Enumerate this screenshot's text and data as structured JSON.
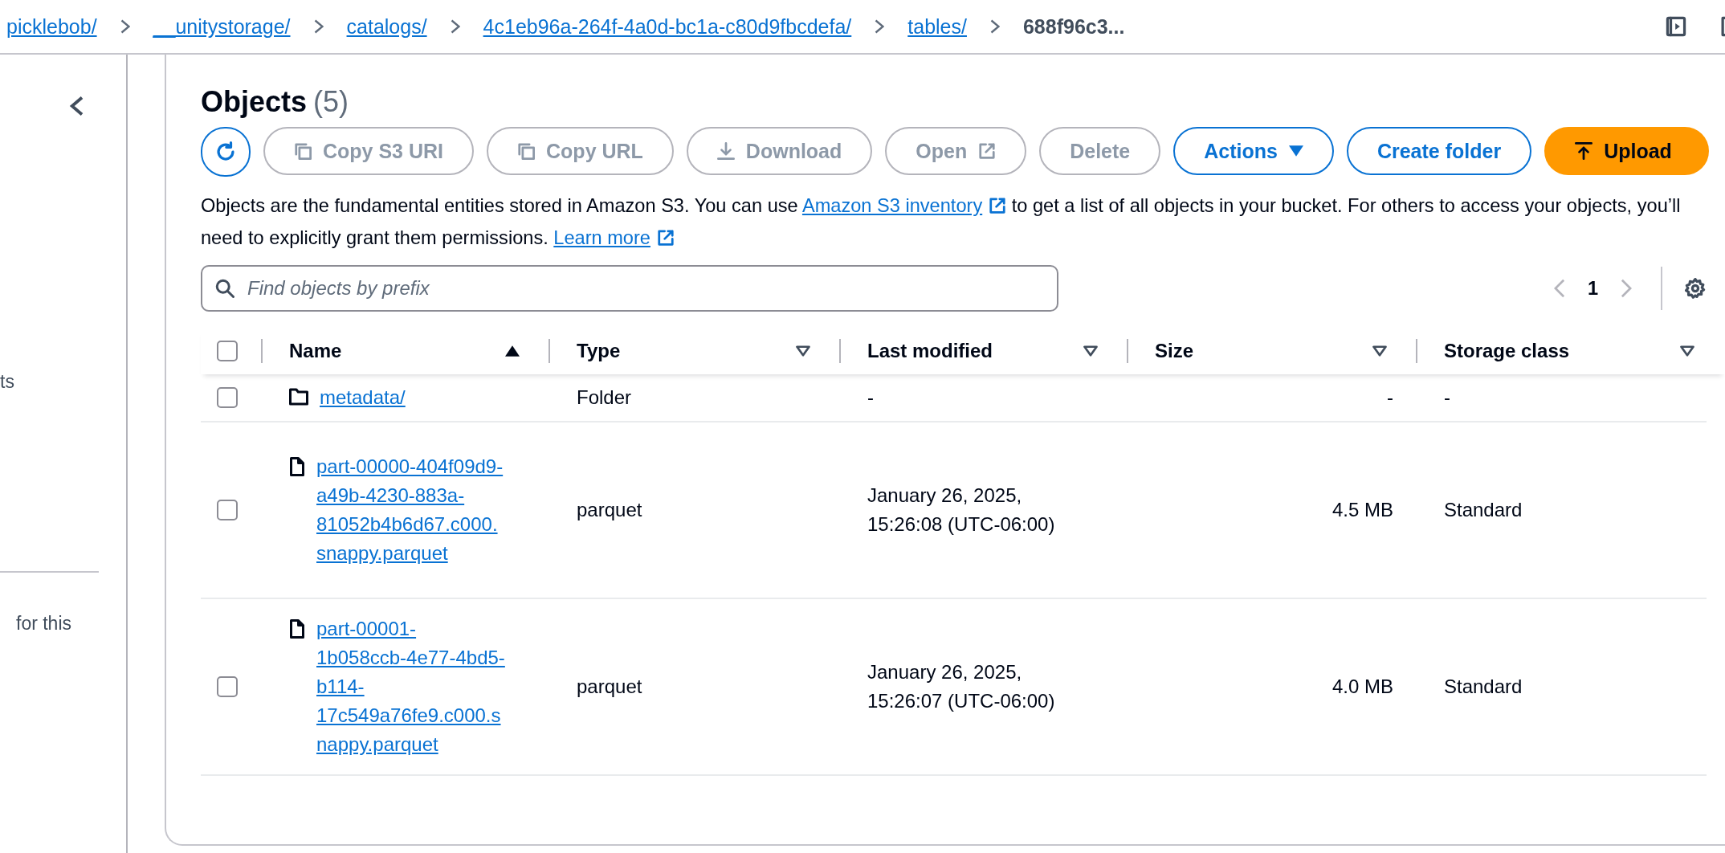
{
  "breadcrumb": [
    {
      "label": "picklebob/",
      "current": false
    },
    {
      "label": "__unitystorage/",
      "current": false
    },
    {
      "label": "catalogs/",
      "current": false
    },
    {
      "label": "4c1eb96a-264f-4a0d-bc1a-c80d9fbcdefa/",
      "current": false
    },
    {
      "label": "tables/",
      "current": false
    },
    {
      "label": "688f96c3...",
      "current": true
    }
  ],
  "sidebar": {
    "texts": [
      "ts",
      "for this"
    ]
  },
  "objects": {
    "title": "Objects",
    "count": "(5)"
  },
  "toolbar": {
    "buttons": [
      {
        "kind": "refresh",
        "disabled": false
      },
      {
        "kind": "copy",
        "label": "Copy S3 URI",
        "disabled": true
      },
      {
        "kind": "copy",
        "label": "Copy URL",
        "disabled": true
      },
      {
        "kind": "download",
        "label": "Download",
        "disabled": true
      },
      {
        "kind": "external",
        "label": "Open",
        "disabled": true
      },
      {
        "kind": "plain",
        "label": "Delete",
        "disabled": true
      },
      {
        "kind": "dropdown",
        "label": "Actions",
        "disabled": false
      },
      {
        "kind": "plain",
        "label": "Create folder",
        "disabled": false
      },
      {
        "kind": "upload",
        "label": "Upload",
        "disabled": false
      }
    ]
  },
  "description": [
    {
      "kind": "text",
      "text": "Objects are the fundamental entities stored in Amazon S3. You can use "
    },
    {
      "kind": "link",
      "text": "Amazon S3 inventory"
    },
    {
      "kind": "text",
      "text": " to get a list of all objects in your bucket. For others to access your objects, you’ll need to explicitly grant them permissions. "
    },
    {
      "kind": "link",
      "text": "Learn more"
    }
  ],
  "search": {
    "placeholder": "Find objects by prefix"
  },
  "pagination": {
    "page": "1"
  },
  "table": {
    "select_all": {
      "selected": false
    },
    "columns": [
      {
        "label": "Name",
        "sorted": true
      },
      {
        "label": "Type",
        "sorted": false
      },
      {
        "label": "Last modified",
        "sorted": false
      },
      {
        "label": "Size",
        "sorted": false
      },
      {
        "label": "Storage class",
        "sorted": false
      }
    ],
    "rows": [
      {
        "selected": false,
        "kind": "folder",
        "name": "metadata/",
        "type": "Folder",
        "last_modified": "-",
        "size": "-",
        "storage_class": "-"
      },
      {
        "selected": false,
        "kind": "file",
        "name": "part-00000-404f09d9-a49b-4230-883a-81052b4b6d67.c000.snappy.parquet",
        "type": "parquet",
        "last_modified": "January 26, 2025, 15:26:08 (UTC-06:00)",
        "size": "4.5 MB",
        "storage_class": "Standard"
      },
      {
        "selected": false,
        "kind": "file",
        "name": "part-00001-1b058ccb-4e77-4bd5-b114-17c549a76fe9.c000.snappy.parquet",
        "type": "parquet",
        "last_modified": "January 26, 2025, 15:26:07 (UTC-06:00)",
        "size": "4.0 MB",
        "storage_class": "Standard"
      }
    ]
  }
}
